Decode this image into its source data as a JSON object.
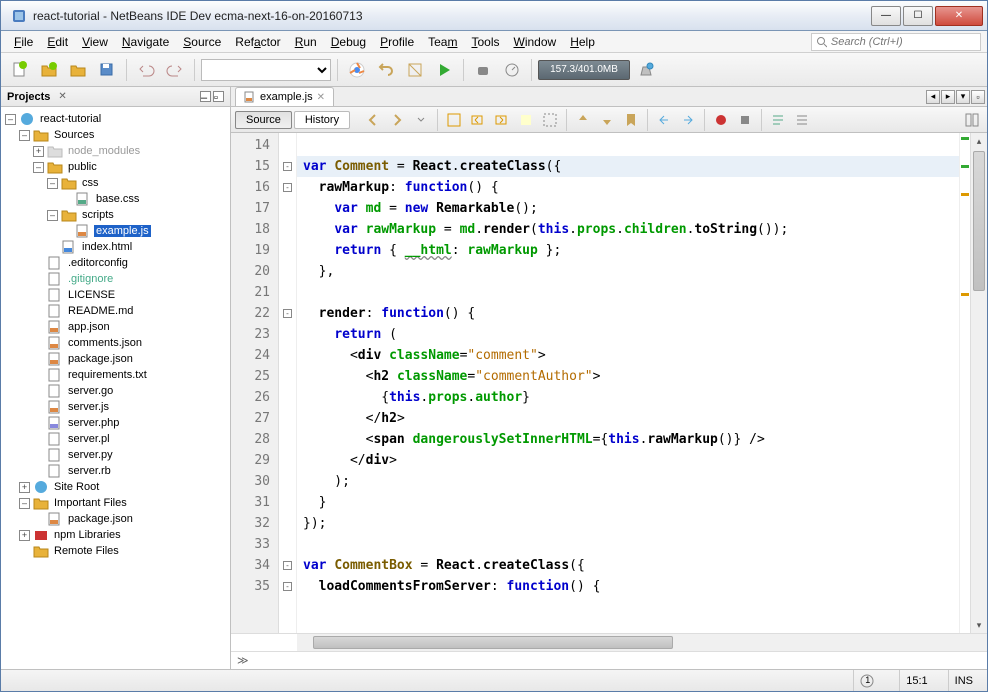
{
  "window": {
    "title": "react-tutorial - NetBeans IDE Dev ecma-next-16-on-20160713"
  },
  "menu": {
    "file": "File",
    "edit": "Edit",
    "view": "View",
    "navigate": "Navigate",
    "source": "Source",
    "refactor": "Refactor",
    "run": "Run",
    "debug": "Debug",
    "profile": "Profile",
    "team": "Team",
    "tools": "Tools",
    "window": "Window",
    "help": "Help"
  },
  "search": {
    "placeholder": "Search (Ctrl+I)"
  },
  "memory": {
    "text": "157.3/401.0MB"
  },
  "sidebar": {
    "panel_title": "Projects",
    "project": "react-tutorial",
    "sources": "Sources",
    "nodes": {
      "node_modules": "node_modules",
      "public": "public",
      "css": "css",
      "base_css": "base.css",
      "scripts": "scripts",
      "example_js": "example.js",
      "index_html": "index.html",
      "editorconfig": ".editorconfig",
      "gitignore": ".gitignore",
      "license": "LICENSE",
      "readme": "README.md",
      "app_json": "app.json",
      "comments_json": "comments.json",
      "package_json": "package.json",
      "requirements": "requirements.txt",
      "server_go": "server.go",
      "server_js": "server.js",
      "server_php": "server.php",
      "server_pl": "server.pl",
      "server_py": "server.py",
      "server_rb": "server.rb",
      "site_root": "Site Root",
      "important_files": "Important Files",
      "package_json2": "package.json",
      "npm_libs": "npm Libraries",
      "remote_files": "Remote Files"
    }
  },
  "tabs": {
    "example_js": "example.js"
  },
  "editor_tabs": {
    "source": "Source",
    "history": "History"
  },
  "code": {
    "line_numbers": [
      "14",
      "15",
      "16",
      "17",
      "18",
      "19",
      "20",
      "21",
      "22",
      "23",
      "24",
      "25",
      "26",
      "27",
      "28",
      "29",
      "30",
      "31",
      "32",
      "33",
      "34",
      "35"
    ],
    "folds": [
      "",
      "-",
      "-",
      "",
      "",
      "",
      "",
      "",
      "-",
      "",
      "",
      "",
      "",
      "",
      "",
      "",
      "",
      "",
      "",
      "",
      "-",
      "-"
    ],
    "lines": {
      "l15_var": "var",
      "l15_Comment": "Comment",
      "l15_React": "React",
      "l15_cc": "createClass",
      "l16_rm": "rawMarkup",
      "l16_fn": "function",
      "l17_var": "var",
      "l17_md": "md",
      "l17_new": "new",
      "l17_Remarkable": "Remarkable",
      "l18_var": "var",
      "l18_rm": "rawMarkup",
      "l18_md": "md",
      "l18_render": "render",
      "l18_this": "this",
      "l18_props": "props",
      "l18_children": "children",
      "l18_ts": "toString",
      "l19_return": "return",
      "l19_html": "__html",
      "l19_rm": "rawMarkup",
      "l22_render": "render",
      "l22_fn": "function",
      "l23_return": "return",
      "l24_div": "div",
      "l24_cn": "className",
      "l24_val": "\"comment\"",
      "l25_h2": "h2",
      "l25_cn": "className",
      "l25_val": "\"commentAuthor\"",
      "l26_this": "this",
      "l26_props": "props",
      "l26_author": "author",
      "l27_h2": "h2",
      "l28_span": "span",
      "l28_dsi": "dangerouslySetInnerHTML",
      "l28_this": "this",
      "l28_rm": "rawMarkup",
      "l29_div": "div",
      "l34_var": "var",
      "l34_CB": "CommentBox",
      "l34_React": "React",
      "l34_cc": "createClass",
      "l35_lc": "loadCommentsFromServer",
      "l35_fn": "function"
    }
  },
  "status": {
    "notif": "1",
    "pos": "15:1",
    "ins": "INS"
  }
}
